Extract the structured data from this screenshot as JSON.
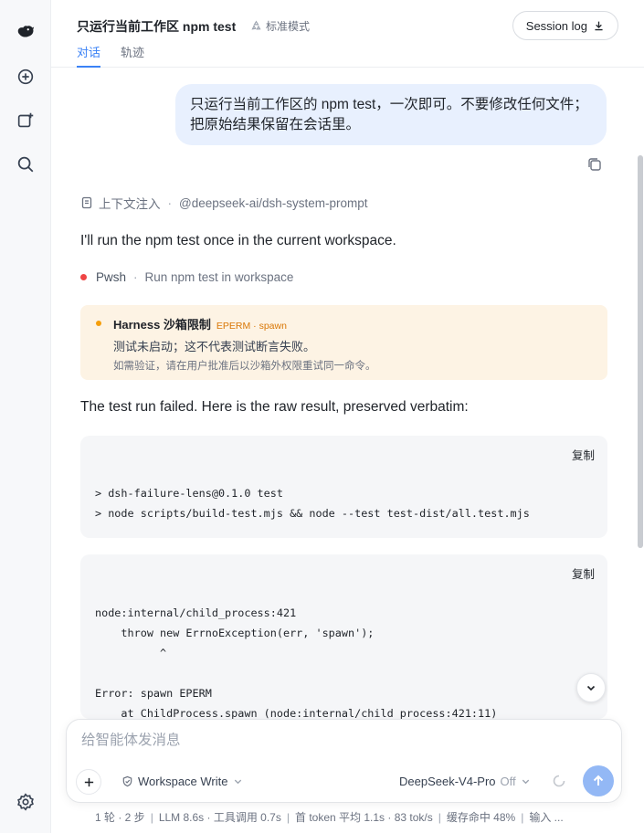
{
  "app": {
    "title": "只运行当前工作区 npm test",
    "mode": "标准模式",
    "session_log_label": "Session log",
    "tabs": [
      {
        "label": "对话",
        "active": true
      },
      {
        "label": "轨迹",
        "active": false
      }
    ]
  },
  "rail": {
    "icons": [
      "logo-icon",
      "new-chat-icon",
      "add-item-icon",
      "search-icon",
      "settings-icon"
    ]
  },
  "conversation": {
    "user_message": "只运行当前工作区的 npm test，一次即可。不要修改任何文件；把原始结果保留在会话里。",
    "context_label": "上下文注入",
    "context_source": "@deepseek-ai/dsh-system-prompt",
    "assistant_intro": "I'll run the npm test once in the current workspace.",
    "tool_name": "Pwsh",
    "tool_desc": "Run npm test in workspace",
    "warning": {
      "title": "Harness 沙箱限制",
      "tag": "EPERM · spawn",
      "line1": "测试未启动；这不代表测试断言失败。",
      "line2": "如需验证，请在用户批准后以沙箱外权限重试同一命令。"
    },
    "assistant_result": "The test run failed. Here is the raw result, preserved verbatim:",
    "code_blocks": [
      {
        "copy_label": "复制",
        "content": "> dsh-failure-lens@0.1.0 test\n> node scripts/build-test.mjs && node --test test-dist/all.test.mjs"
      },
      {
        "copy_label": "复制",
        "content": "node:internal/child_process:421\n    throw new ErrnoException(err, 'spawn');\n          ^\n\nError: spawn EPERM\n    at ChildProcess.spawn (node:internal/child_process:421:11)"
      }
    ]
  },
  "composer": {
    "placeholder": "给智能体发消息",
    "workspace_label": "Workspace Write",
    "model_label": "DeepSeek-V4-Pro",
    "model_state": "Off"
  },
  "status_bar": {
    "items": [
      "1 轮 · 2 步",
      "LLM 8.6s · 工具调用 0.7s",
      "首 token 平均 1.1s · 83 tok/s",
      "缓存命中 48%",
      "输入 ..."
    ]
  },
  "colors": {
    "accent": "#3b82f6",
    "user_bubble": "#e8f0fe",
    "warning_bg": "#fdf3e4",
    "warning_dot": "#f59e0b",
    "error_dot": "#ef4444",
    "send_button": "#93b8f5"
  }
}
